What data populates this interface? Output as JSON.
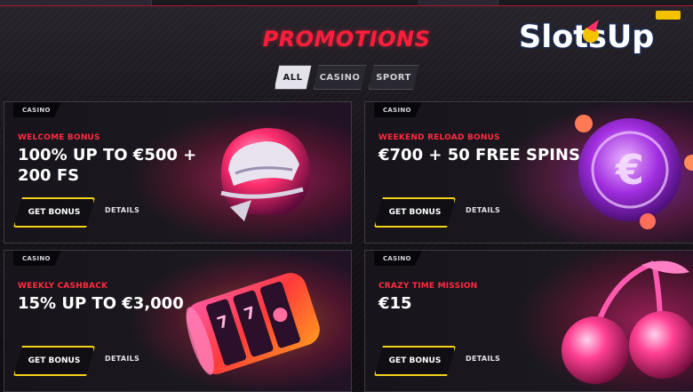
{
  "page": {
    "title": "PROMOTIONS",
    "logo_text": "SlotsUp"
  },
  "filters": [
    {
      "label": "ALL",
      "active": true
    },
    {
      "label": "CASINO",
      "active": false
    },
    {
      "label": "SPORT",
      "active": false
    }
  ],
  "promotions": [
    {
      "tag": "CASINO",
      "subtitle": "WELCOME BONUS",
      "headline": "100% UP TO €500 + 200 FS",
      "button": "GET BONUS",
      "details": "DETAILS",
      "art": "racing-helmet-icon"
    },
    {
      "tag": "CASINO",
      "subtitle": "WEEKEND RELOAD BONUS",
      "headline": "€700 + 50 FREE SPINS",
      "button": "GET BONUS",
      "details": "DETAILS",
      "art": "euro-coin-icon"
    },
    {
      "tag": "CASINO",
      "subtitle": "WEEKLY CASHBACK",
      "headline": "15% UP TO €3,000",
      "button": "GET BONUS",
      "details": "DETAILS",
      "art": "slot-reels-icon"
    },
    {
      "tag": "CASINO",
      "subtitle": "CRAZY TIME MISSION",
      "headline": "€15",
      "button": "GET BONUS",
      "details": "DETAILS",
      "art": "cherries-icon"
    }
  ],
  "colors": {
    "accent_red": "#ff1d3c",
    "button_border": "#f6d21a",
    "card_bg": "#1a171f"
  }
}
